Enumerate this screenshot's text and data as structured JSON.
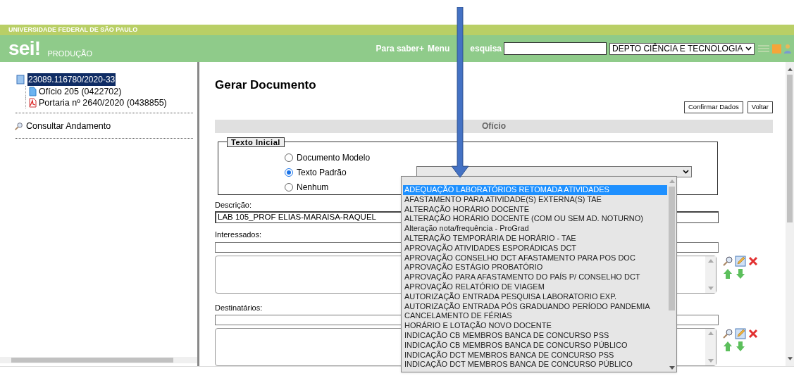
{
  "header": {
    "institution": "UNIVERSIDADE FEDERAL DE SÃO PAULO",
    "logo": "sei!",
    "environment": "PRODUÇÃO",
    "links": [
      "Para saber+",
      "Menu"
    ],
    "search_label": "esquisa",
    "unit_select": "DEPTO CIÊNCIA E TECNOLOGIA"
  },
  "sidebar": {
    "process": {
      "label": "23089.116780/2020-33",
      "selected": true
    },
    "documents": [
      {
        "label": "Ofício 205 (0422702)",
        "kind": "document"
      },
      {
        "label": "Portaria nº 2640/2020 (0438855)",
        "kind": "pdf"
      }
    ],
    "actions": [
      "Consultar Andamento"
    ]
  },
  "main": {
    "title": "Gerar Documento",
    "buttons": [
      "Confirmar Dados",
      "Voltar"
    ],
    "section_title": "Ofício",
    "initial_text": {
      "legend": "Texto Inicial",
      "options": [
        {
          "label": "Documento Modelo",
          "selected": false
        },
        {
          "label": "Texto Padrão",
          "selected": true
        },
        {
          "label": "Nenhum",
          "selected": false
        }
      ]
    },
    "template_select": {
      "expanded": true,
      "options": [
        {
          "label": "ADEQUAÇÃO LABORATÓRIOS RETOMADA ATIVIDADES",
          "selected": true
        },
        {
          "label": "AFASTAMENTO PARA ATIVIDADE(S) EXTERNA(S) TAE",
          "selected": false
        },
        {
          "label": "ALTERAÇÃO HORÁRIO DOCENTE",
          "selected": false
        },
        {
          "label": "ALTERAÇÃO HORÁRIO DOCENTE (COM OU SEM AD. NOTURNO)",
          "selected": false
        },
        {
          "label": "Alteração nota/frequência - ProGrad",
          "selected": false
        },
        {
          "label": "ALTERAÇÃO TEMPORÁRIA DE HORÁRIO - TAE",
          "selected": false
        },
        {
          "label": "APROVAÇÃO ATIVIDADES ESPORÁDICAS DCT",
          "selected": false
        },
        {
          "label": "APROVAÇÃO CONSELHO DCT AFASTAMENTO PARA POS DOC",
          "selected": false
        },
        {
          "label": "APROVAÇÃO ESTÁGIO PROBATÓRIO",
          "selected": false
        },
        {
          "label": "APROVAÇÃO PARA AFASTAMENTO DO PAÍS P/ CONSELHO DCT",
          "selected": false
        },
        {
          "label": "APROVAÇÃO RELATÓRIO DE VIAGEM",
          "selected": false
        },
        {
          "label": "AUTORIZAÇÃO ENTRADA PESQUISA LABORATORIO EXP.",
          "selected": false
        },
        {
          "label": "AUTORIZAÇÃO ENTRADA PÓS GRADUANDO PERÍODO PANDEMIA",
          "selected": false
        },
        {
          "label": "CANCELAMENTO DE FÉRIAS",
          "selected": false
        },
        {
          "label": "HORÁRIO E LOTAÇÃO NOVO DOCENTE",
          "selected": false
        },
        {
          "label": "INDICAÇÃO CB MEMBROS BANCA DE CONCURSO PSS",
          "selected": false
        },
        {
          "label": "INDICAÇÃO CB MEMBROS BANCA DE CONCURSO PÚBLICO",
          "selected": false
        },
        {
          "label": "INDICAÇÃO DCT MEMBROS BANCA DE CONCURSO PSS",
          "selected": false
        },
        {
          "label": "INDICAÇÃO DCT MEMBROS BANCA DE CONCURSO PÚBLICO",
          "selected": false
        }
      ]
    },
    "description": {
      "label": "Descrição:",
      "value": "LAB 105_PROF ELIAS-MARAISA-RAQUEL"
    },
    "interested": {
      "label": "Interessados:"
    },
    "recipients": {
      "label": "Destinatários:"
    }
  },
  "annotation": {
    "kind": "arrow"
  }
}
